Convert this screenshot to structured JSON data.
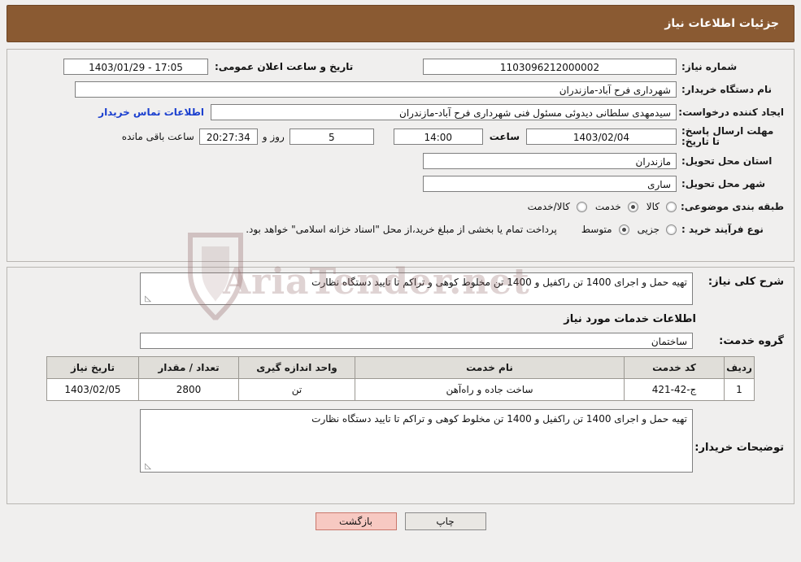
{
  "header": {
    "title": "جزئیات اطلاعات نیاز"
  },
  "form": {
    "need_number_label": "شماره نیاز:",
    "need_number_value": "1103096212000002",
    "announce_date_label": "تاریخ و ساعت اعلان عمومی:",
    "announce_date_value": "17:05 - 1403/01/29",
    "buyer_org_label": "نام دستگاه خریدار:",
    "buyer_org_value": "شهرداری فرح آباد-مازندران",
    "requester_label": "ایجاد کننده درخواست:",
    "requester_value": "سیدمهدی سلطانی دیدوئی مسئول فنی شهرداری فرح آباد-مازندران",
    "contact_link": "اطلاعات تماس خریدار",
    "deadline_label": "مهلت ارسال پاسخ: تا تاریخ:",
    "deadline_date": "1403/02/04",
    "hour_label": "ساعت",
    "deadline_time": "14:00",
    "days_value": "5",
    "days_label": "روز و",
    "countdown_value": "20:27:34",
    "remaining_label": "ساعت باقی مانده",
    "province_label": "استان محل تحویل:",
    "province_value": "مازندران",
    "city_label": "شهر محل تحویل:",
    "city_value": "ساری",
    "category_label": "طبقه بندی موضوعی:",
    "category_options": [
      {
        "label": "کالا",
        "checked": false
      },
      {
        "label": "خدمت",
        "checked": true
      },
      {
        "label": "کالا/خدمت",
        "checked": false
      }
    ],
    "process_label": "نوع فرآیند خرید :",
    "process_options": [
      {
        "label": "جزیی",
        "checked": false
      },
      {
        "label": "متوسط",
        "checked": true
      }
    ],
    "process_note": "پرداخت تمام یا بخشی از مبلغ خرید،از محل \"اسناد خزانه اسلامی\" خواهد بود."
  },
  "description": {
    "general_label": "شرح کلی نیاز:",
    "general_value": "تهیه حمل و اجرای 1400 تن راکفیل و 1400 تن مخلوط کوهی و تراکم تا تایید دستگاه نظارت",
    "services_title": "اطلاعات خدمات مورد نیاز",
    "service_group_label": "گروه خدمت:",
    "service_group_value": "ساختمان",
    "buyer_notes_label": "توضیحات خریدار:",
    "buyer_notes_value": "تهیه حمل و اجرای 1400 تن راکفیل و 1400 تن مخلوط کوهی و تراکم تا تایید دستگاه نظارت"
  },
  "table": {
    "headers": [
      "ردیف",
      "کد خدمت",
      "نام خدمت",
      "واحد اندازه گیری",
      "تعداد / مقدار",
      "تاریخ نیاز"
    ],
    "rows": [
      {
        "row": "1",
        "code": "ج-42-421",
        "name": "ساخت جاده و راه‌آهن",
        "unit": "تن",
        "qty": "2800",
        "date": "1403/02/05"
      }
    ]
  },
  "footer": {
    "print_label": "چاپ",
    "back_label": "بازگشت"
  },
  "watermark": {
    "text": "AriaTender.net"
  }
}
